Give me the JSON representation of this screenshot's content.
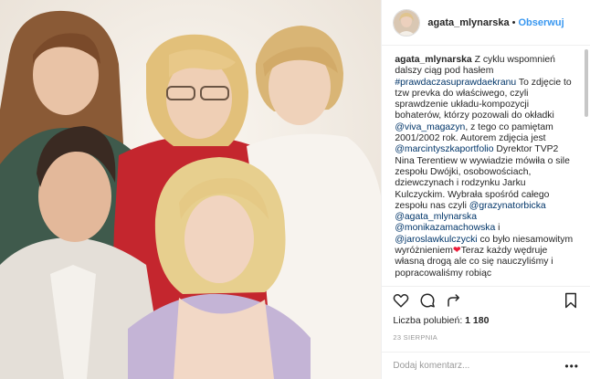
{
  "header": {
    "username": "agata_mlynarska",
    "separator": "•",
    "follow_label": "Obserwuj"
  },
  "caption": {
    "username": "agata_mlynarska",
    "text1": " Z cyklu wspomnień dalszy ciąg pod hasłem ",
    "hashtag": "#prawdaczasuprawdaekranu",
    "text2": " To zdjęcie to tzw prevka do właściwego, czyli sprawdzenie układu-kompozycji bohaterów, którzy pozowali do okładki ",
    "mention_viva": "@viva_magazyn",
    "text3": ", z tego co pamiętam 2001/2002 rok. Autorem zdjęcia jest ",
    "mention_marcin": "@marcintyszkaportfolio",
    "text4": " Dyrektor TVP2 Nina Terentiew w wywiadzie mówiła o sile zespołu Dwójki, osobowościach, dziewczynach i rodzynku Jarku Kulczyckim. Wybrała spośród całego zespołu nas czyli ",
    "mention_grazyna": "@grazynatorbicka",
    "mention_agata": "@agata_mlynarska",
    "mention_monika": "@monikazamachowska",
    "text5": " i ",
    "mention_jarek": "@jaroslawkulczycki",
    "text6": " co było niesamowitym wyróżnieniem",
    "heart": "❤",
    "text7": "Teraz każdy wędruje własną drogą ale co się nauczyliśmy i popracowaliśmy robiąc"
  },
  "likes": {
    "label": "Liczba polubień:",
    "count": "1 180"
  },
  "date": "23 SIERPNIA",
  "comment": {
    "placeholder": "Dodaj komentarz...",
    "more": "•••"
  },
  "icons": {
    "like": "heart-outline-icon",
    "comment": "comment-bubble-icon",
    "share": "share-arrow-icon",
    "save": "bookmark-icon"
  },
  "colors": {
    "link": "#3897f0",
    "tag": "#003569",
    "heart": "#ed1c3a",
    "text": "#262626",
    "muted": "#999999"
  }
}
